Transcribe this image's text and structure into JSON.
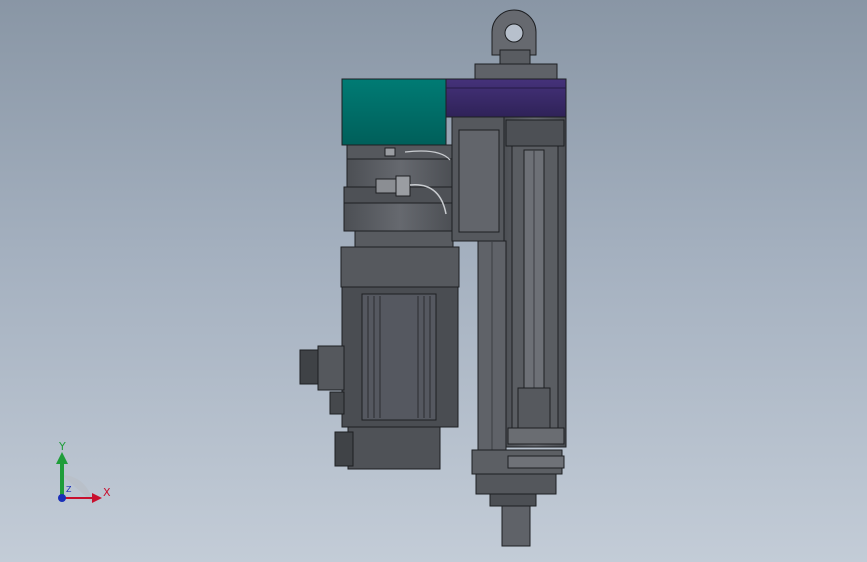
{
  "viewport": {
    "background_top": "#8996a5",
    "background_bottom": "#c3ccd7"
  },
  "model": {
    "colors": {
      "body": "#5b5e63",
      "body_dark": "#3f4246",
      "body_light": "#70747a",
      "edge": "#1d1f22",
      "teal_block": "#00706a",
      "purple_block": "#3a2a6a"
    }
  },
  "triad": {
    "x_label": "X",
    "y_label": "Y",
    "z_label": "Z",
    "x_color": "#c8102e",
    "y_color": "#1f9d3a",
    "z_color": "#1a2fb8",
    "icon": "coordinate-triad-icon"
  }
}
